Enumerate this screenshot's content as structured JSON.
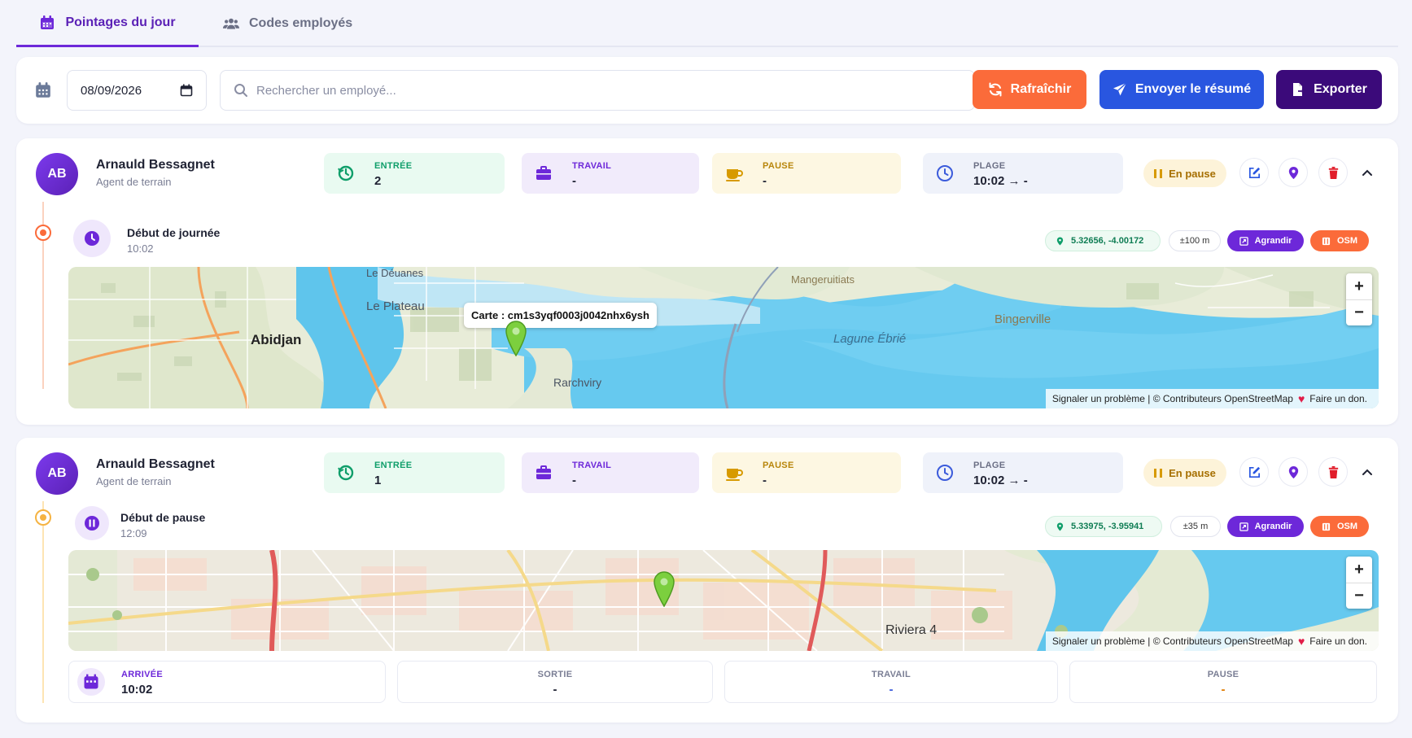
{
  "tabs": [
    {
      "label": "Pointages du jour",
      "icon": "calendar-icon",
      "active": true
    },
    {
      "label": "Codes employés",
      "icon": "users-icon",
      "active": false
    }
  ],
  "toolbar": {
    "date_value": "08/09/2026",
    "search_placeholder": "Rechercher un employé...",
    "refresh_label": "Rafraîchir",
    "send_label": "Envoyer le résumé",
    "export_label": "Exporter"
  },
  "colors": {
    "accent": "#6d28d9",
    "refresh": "#fb6b3a",
    "send": "#2956e0",
    "export": "#3b0a7a"
  },
  "cards": [
    {
      "initials": "AB",
      "name": "Arnauld Bessagnet",
      "role": "Agent de terrain",
      "stats": {
        "entree_label": "ENTRÉE",
        "entree_value": "2",
        "travail_label": "TRAVAIL",
        "travail_value": "-",
        "pause_label": "PAUSE",
        "pause_value": "-",
        "plage_label": "PLAGE",
        "plage_value": "10:02 → -"
      },
      "status": "En pause",
      "event": {
        "title": "Début de journée",
        "time": "10:02",
        "coords": "5.32656, -4.00172",
        "accuracy": "±100 m",
        "enlarge_label": "Agrandir",
        "osm_label": "OSM"
      },
      "map": {
        "popup": "Carte : cm1s3yqf0003j0042nhx6ysh",
        "places": [
          "Abidjan",
          "Le Plateau",
          "Lagune Ébrié",
          "Bingerville",
          "Le Déuanes",
          "Mangeruitiats",
          "Rarchviry"
        ],
        "attribution_prefix": "Signaler un problème | © Contributeurs OpenStreetMap",
        "attribution_suffix": "Faire un don."
      }
    },
    {
      "initials": "AB",
      "name": "Arnauld Bessagnet",
      "role": "Agent de terrain",
      "stats": {
        "entree_label": "ENTRÉE",
        "entree_value": "1",
        "travail_label": "TRAVAIL",
        "travail_value": "-",
        "pause_label": "PAUSE",
        "pause_value": "-",
        "plage_label": "PLAGE",
        "plage_value": "10:02 → -"
      },
      "status": "En pause",
      "event": {
        "title": "Début de pause",
        "time": "12:09",
        "coords": "5.33975, -3.95941",
        "accuracy": "±35 m",
        "enlarge_label": "Agrandir",
        "osm_label": "OSM"
      },
      "map": {
        "places": [
          "Riviera 4"
        ],
        "attribution_prefix": "Signaler un problème | © Contributeurs OpenStreetMap",
        "attribution_suffix": "Faire un don."
      },
      "summary": {
        "arrivee_label": "ARRIVÉE",
        "arrivee_value": "10:02",
        "sortie_label": "SORTIE",
        "sortie_value": "-",
        "travail_label": "TRAVAIL",
        "travail_value": "-",
        "pause_label": "PAUSE",
        "pause_value": "-"
      }
    }
  ]
}
